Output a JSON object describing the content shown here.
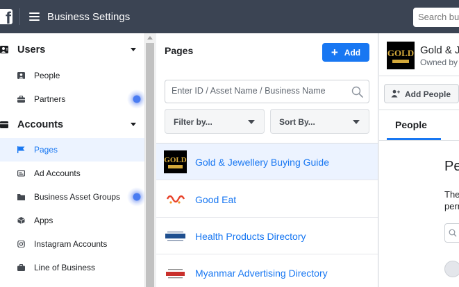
{
  "topbar": {
    "logo": "f",
    "title": "Business Settings",
    "search_placeholder": "Search business"
  },
  "sidebar": {
    "sections": [
      {
        "label": "Users",
        "icon": "users-icon"
      },
      {
        "label": "Accounts",
        "icon": "accounts-icon"
      }
    ],
    "items": [
      {
        "label": "People",
        "icon": "person-icon"
      },
      {
        "label": "Partners",
        "icon": "briefcase-icon"
      },
      {
        "label": "Pages",
        "icon": "flag-icon",
        "active": true
      },
      {
        "label": "Ad Accounts",
        "icon": "ad-account-icon"
      },
      {
        "label": "Business Asset Groups",
        "icon": "folder-icon"
      },
      {
        "label": "Apps",
        "icon": "cube-icon"
      },
      {
        "label": "Instagram Accounts",
        "icon": "instagram-icon"
      },
      {
        "label": "Line of Business",
        "icon": "briefcase-icon"
      }
    ]
  },
  "pages_panel": {
    "title": "Pages",
    "add_label": "Add",
    "search_placeholder": "Enter ID / Asset Name / Business Name",
    "filter_label": "Filter by...",
    "sort_label": "Sort By...",
    "rows": [
      {
        "name": "Gold & Jewellery Buying Guide",
        "selected": true
      },
      {
        "name": "Good Eat"
      },
      {
        "name": "Health Products Directory"
      },
      {
        "name": "Myanmar Advertising Directory"
      }
    ]
  },
  "detail_panel": {
    "page_name": "Gold & Jewellery Buying Guide",
    "owned_by": "Owned by",
    "add_people_label": "Add People",
    "tab_label": "People",
    "heading": "People",
    "desc_line1": "These people",
    "desc_line2": "permission"
  },
  "colors": {
    "topbar": "#3b4453",
    "accent": "#1877f2",
    "active_bg": "#ecf3ff"
  }
}
